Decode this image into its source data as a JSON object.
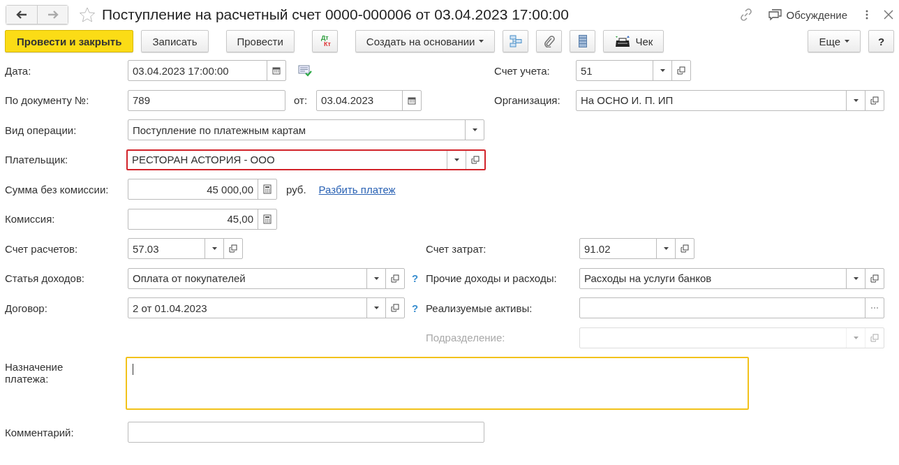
{
  "window": {
    "title": "Поступление на расчетный счет 0000-000006 от 03.04.2023 17:00:00",
    "favorite": false,
    "discussion": "Обсуждение"
  },
  "toolbar": {
    "left": [
      {
        "kind": "primary",
        "label": "Провести и закрыть"
      },
      {
        "kind": "plain",
        "label": "Записать"
      },
      {
        "kind": "plain",
        "label": "Провести"
      },
      {
        "kind": "dtkt",
        "label": "Дт",
        "sublabel": "Кт"
      },
      {
        "kind": "menu",
        "label": "Создать на основании"
      },
      {
        "kind": "structure"
      },
      {
        "kind": "files"
      },
      {
        "kind": "register"
      },
      {
        "kind": "receipt",
        "label": "Чек"
      }
    ],
    "right": [
      {
        "kind": "menu",
        "label": "Еще"
      },
      {
        "kind": "help",
        "label": "?"
      }
    ]
  },
  "header": {
    "date": {
      "label": "Дата:",
      "value": "03.04.2023 17:00:00",
      "posted": true
    },
    "account": {
      "label": "Счет учета:",
      "value": "51"
    },
    "doc_number": {
      "label": "По документу №:",
      "value": "789"
    },
    "doc_date": {
      "label": "от:",
      "value": "03.04.2023"
    },
    "organization": {
      "label": "Организация:",
      "value": "На ОСНО И. П. ИП"
    },
    "operation": {
      "label": "Вид операции:",
      "value": "Поступление по платежным картам"
    },
    "payer": {
      "label": "Плательщик:",
      "value": "РЕСТОРАН АСТОРИЯ - ООО",
      "error": true
    },
    "amount": {
      "label": "Сумма без комиссии:",
      "value": "45 000,00",
      "currency": "руб.",
      "link": "Разбить платеж"
    },
    "commission": {
      "label": "Комиссия:",
      "value": "45,00"
    }
  },
  "accounts": {
    "settlement_account": {
      "label": "Счет расчетов:",
      "value": "57.03"
    },
    "cost_account": {
      "label": "Счет затрат:",
      "value": "91.02"
    },
    "income_item": {
      "label": "Статья доходов:",
      "value": "Оплата от покупателей",
      "hint": "?"
    },
    "other_income": {
      "label": "Прочие доходы и расходы:",
      "value": "Расходы на услуги банков"
    },
    "contract": {
      "label": "Договор:",
      "value": "2 от 01.04.2023",
      "hint": "?"
    },
    "assets": {
      "label": "Реализуемые активы:"
    },
    "department": {
      "label": "Подразделение:",
      "disabled": true
    }
  },
  "purpose": {
    "label": "Назначение платежа:",
    "focused": true
  },
  "comment": {
    "label": "Комментарий:"
  }
}
